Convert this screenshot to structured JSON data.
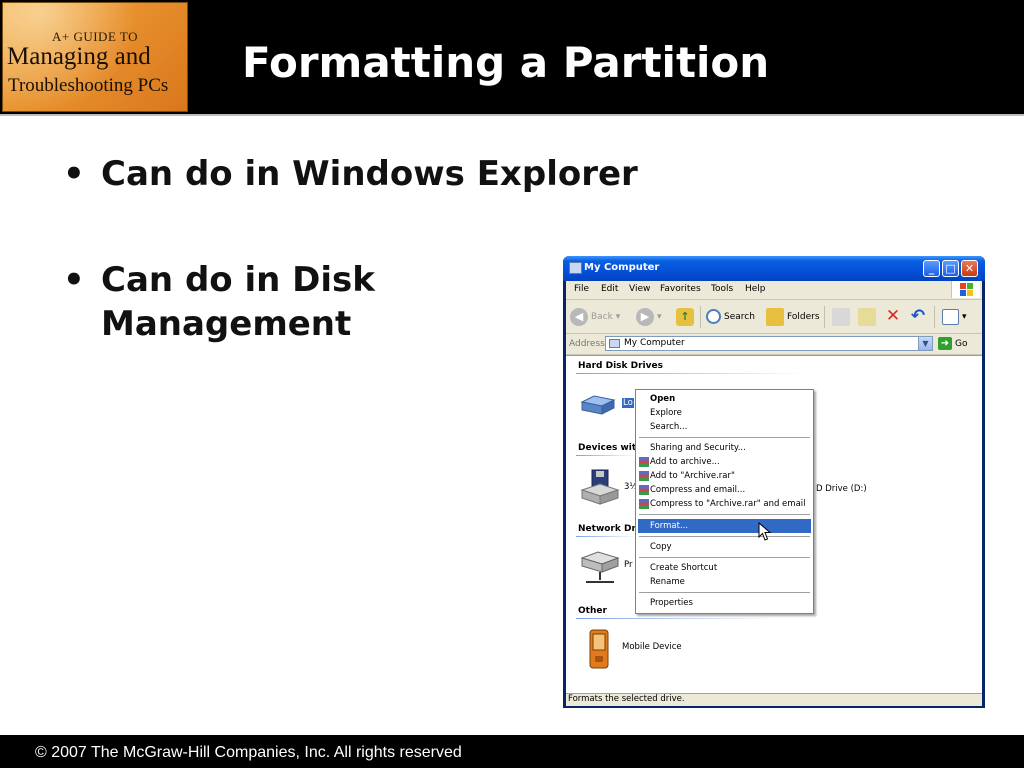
{
  "slide": {
    "title": "Formatting a Partition",
    "logo": {
      "line1": "A+ GUIDE TO",
      "line2": "Managing and",
      "line3": "Troubleshooting PCs"
    },
    "bullets": [
      {
        "line1": "Can do in Windows Explorer",
        "line2": ""
      },
      {
        "line1": "Can do in Disk",
        "line2": "Management"
      }
    ],
    "footer": "© 2007 The McGraw-Hill Companies, Inc. All rights reserved"
  },
  "window": {
    "title": "My Computer",
    "controls": {
      "minimize": "_",
      "maximize": "□",
      "close": "✕"
    },
    "menu": [
      "File",
      "Edit",
      "View",
      "Favorites",
      "Tools",
      "Help"
    ],
    "toolbar": {
      "back": "Back",
      "search": "Search",
      "folders": "Folders"
    },
    "address": {
      "label": "Address",
      "value": "My Computer",
      "go": "Go"
    },
    "groups": {
      "hard_disk": "Hard Disk Drives",
      "devices": "Devices wit",
      "network": "Network Dri",
      "other": "Other"
    },
    "items": {
      "local_disk": "Lo",
      "floppy": "3½",
      "dvd": "D Drive (D:)",
      "network_drive": "Pr",
      "mobile": "Mobile Device"
    },
    "status": "Formats the selected drive."
  },
  "context_menu": {
    "items": [
      {
        "label": "Open"
      },
      {
        "label": "Explore"
      },
      {
        "label": "Search..."
      },
      {
        "label": "Sharing and Security..."
      },
      {
        "label": "Add to archive..."
      },
      {
        "label": "Add to \"Archive.rar\""
      },
      {
        "label": "Compress and email..."
      },
      {
        "label": "Compress to \"Archive.rar\" and email"
      },
      {
        "label": "Format..."
      },
      {
        "label": "Copy"
      },
      {
        "label": "Create Shortcut"
      },
      {
        "label": "Rename"
      },
      {
        "label": "Properties"
      }
    ],
    "selected_item": "Format...",
    "accent": "#316ac5"
  },
  "colors": {
    "title_bar": "#0550d9",
    "slide_header": "#000000",
    "selection": "#316ac5"
  }
}
